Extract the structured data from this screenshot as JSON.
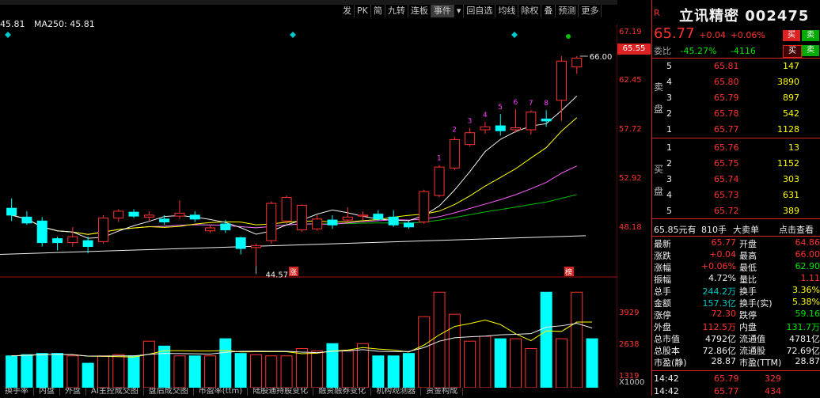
{
  "toolbar": [
    "发",
    "PK",
    "简",
    "九转",
    "连板",
    "事件",
    "",
    "回自选",
    "均线",
    "除权",
    "叠",
    "预测",
    "更多"
  ],
  "ma_legend": [
    {
      "label": "45.81",
      "color": "#ffffff"
    },
    {
      "label": "MA250: 45.81",
      "color": "#ffffff"
    }
  ],
  "axis": {
    "price_ticks": [
      "67.19",
      "62.45",
      "57.72",
      "52.92",
      "48.18"
    ],
    "price_tag": "65.55",
    "volume_ticks": [
      "3929",
      "2638",
      "1319"
    ],
    "volume_unit": "X1000"
  },
  "chart_labels": {
    "high": "66.00",
    "low": "44.57",
    "zhang": "涨",
    "bang": "榜",
    "counts": [
      "1",
      "2",
      "3",
      "4",
      "5",
      "6",
      "7",
      "8"
    ]
  },
  "chart_data": {
    "type": "candlestick",
    "candles": [
      {
        "o": 50.5,
        "c": 49.8,
        "h": 51.5,
        "l": 49.2
      },
      {
        "o": 49.6,
        "c": 49.0,
        "h": 50.2,
        "l": 48.8
      },
      {
        "o": 49.2,
        "c": 47.0,
        "h": 49.6,
        "l": 46.6
      },
      {
        "o": 47.4,
        "c": 47.0,
        "h": 47.6,
        "l": 46.2
      },
      {
        "o": 47.0,
        "c": 47.6,
        "h": 48.6,
        "l": 46.6
      },
      {
        "o": 47.2,
        "c": 46.6,
        "h": 47.6,
        "l": 45.9
      },
      {
        "o": 47.1,
        "c": 49.5,
        "h": 49.8,
        "l": 46.9
      },
      {
        "o": 49.5,
        "c": 50.2,
        "h": 50.4,
        "l": 49.1
      },
      {
        "o": 50.1,
        "c": 49.7,
        "h": 50.4,
        "l": 49.5
      },
      {
        "o": 49.6,
        "c": 49.8,
        "h": 50.2,
        "l": 49.2
      },
      {
        "o": 49.4,
        "c": 49.1,
        "h": 49.8,
        "l": 48.8
      },
      {
        "o": 49.7,
        "c": 50.0,
        "h": 51.3,
        "l": 49.4
      },
      {
        "o": 49.8,
        "c": 49.4,
        "h": 50.2,
        "l": 49.1
      },
      {
        "o": 48.2,
        "c": 48.5,
        "h": 48.8,
        "l": 48.0
      },
      {
        "o": 48.9,
        "c": 48.3,
        "h": 49.3,
        "l": 48.0
      },
      {
        "o": 47.5,
        "c": 46.4,
        "h": 47.6,
        "l": 45.8
      },
      {
        "o": 46.5,
        "c": 46.7,
        "h": 46.9,
        "l": 44.6
      },
      {
        "o": 47.2,
        "c": 51.0,
        "h": 51.2,
        "l": 46.9
      },
      {
        "o": 49.2,
        "c": 51.6,
        "h": 51.8,
        "l": 48.9
      },
      {
        "o": 48.3,
        "c": 50.8,
        "h": 50.9,
        "l": 48.1
      },
      {
        "o": 48.4,
        "c": 49.4,
        "h": 49.8,
        "l": 48.2
      },
      {
        "o": 49.3,
        "c": 48.8,
        "h": 49.8,
        "l": 48.4
      },
      {
        "o": 49.3,
        "c": 49.6,
        "h": 50.6,
        "l": 49.1
      },
      {
        "o": 49.7,
        "c": 49.8,
        "h": 50.2,
        "l": 49.3
      },
      {
        "o": 49.9,
        "c": 49.4,
        "h": 50.3,
        "l": 49.2
      },
      {
        "o": 49.6,
        "c": 48.8,
        "h": 50.3,
        "l": 48.6
      },
      {
        "o": 49.0,
        "c": 48.6,
        "h": 49.2,
        "l": 48.4
      },
      {
        "o": 49.1,
        "c": 52.2,
        "h": 52.4,
        "l": 48.9
      },
      {
        "o": 51.8,
        "c": 54.7,
        "h": 54.9,
        "l": 51.6
      },
      {
        "o": 54.6,
        "c": 57.5,
        "h": 57.8,
        "l": 54.4
      },
      {
        "o": 57.0,
        "c": 58.2,
        "h": 58.7,
        "l": 56.8
      },
      {
        "o": 58.5,
        "c": 58.8,
        "h": 59.3,
        "l": 58.1
      },
      {
        "o": 58.9,
        "c": 58.4,
        "h": 60.1,
        "l": 57.9
      },
      {
        "o": 58.5,
        "c": 58.7,
        "h": 60.6,
        "l": 58.2
      },
      {
        "o": 58.5,
        "c": 60.3,
        "h": 60.5,
        "l": 58.0
      },
      {
        "o": 59.6,
        "c": 59.4,
        "h": 60.5,
        "l": 58.8
      },
      {
        "o": 61.5,
        "c": 65.5,
        "h": 66.0,
        "l": 59.4
      },
      {
        "o": 64.9,
        "c": 65.8,
        "h": 66.0,
        "l": 64.2
      }
    ],
    "volumes": [
      1300,
      1350,
      1400,
      1400,
      1300,
      1000,
      1300,
      1350,
      1300,
      1900,
      1700,
      1300,
      1300,
      1300,
      2000,
      1400,
      1350,
      1300,
      1300,
      1600,
      1500,
      1800,
      1500,
      1800,
      1300,
      1300,
      1400,
      2900,
      3900,
      3000,
      1900,
      2100,
      2000,
      2000,
      1600,
      3900,
      2000,
      3900,
      2000
    ]
  },
  "stock": {
    "r_marker": "R",
    "name": "立讯精密 002475",
    "price": "65.77",
    "change": "+0.04",
    "change_pct": "+0.06%",
    "buy_btn": "买",
    "sell_btn": "卖",
    "ratio_label": "委比",
    "ratio": "-45.27%",
    "ratio_diff": "-4116",
    "side_sell": "卖盘",
    "side_buy": "买盘"
  },
  "asks": [
    {
      "lvl": "5",
      "price": "65.81",
      "vol": "147"
    },
    {
      "lvl": "4",
      "price": "65.80",
      "vol": "3890"
    },
    {
      "lvl": "3",
      "price": "65.79",
      "vol": "897"
    },
    {
      "lvl": "2",
      "price": "65.78",
      "vol": "542"
    },
    {
      "lvl": "1",
      "price": "65.77",
      "vol": "1128"
    }
  ],
  "bids": [
    {
      "lvl": "1",
      "price": "65.76",
      "vol": "13"
    },
    {
      "lvl": "2",
      "price": "65.75",
      "vol": "1152"
    },
    {
      "lvl": "3",
      "price": "65.74",
      "vol": "303"
    },
    {
      "lvl": "4",
      "price": "65.73",
      "vol": "631"
    },
    {
      "lvl": "5",
      "price": "65.72",
      "vol": "389"
    }
  ],
  "big_order": {
    "amount": "65.85元有",
    "hands": "810手",
    "label": "大卖单",
    "link": "点击查看"
  },
  "info": [
    {
      "k1": "最新",
      "v1": "65.77",
      "c1": "red",
      "k2": "开盘",
      "v2": "64.86",
      "c2": "red"
    },
    {
      "k1": "涨跌",
      "v1": "+0.04",
      "c1": "red",
      "k2": "最高",
      "v2": "66.00",
      "c2": "red"
    },
    {
      "k1": "涨幅",
      "v1": "+0.06%",
      "c1": "red",
      "k2": "最低",
      "v2": "62.90",
      "c2": "green"
    },
    {
      "k1": "振幅",
      "v1": "4.72%",
      "c1": "white",
      "k2": "量比",
      "v2": "1.11",
      "c2": "red"
    },
    {
      "k1": "总手",
      "v1": "244.2万",
      "c1": "cyan",
      "k2": "换手",
      "v2": "3.36%",
      "c2": "yellow"
    },
    {
      "k1": "金额",
      "v1": "157.3亿",
      "c1": "cyan",
      "k2": "换手(实)",
      "v2": "5.38%",
      "c2": "yellow"
    },
    {
      "k1": "涨停",
      "v1": "72.30",
      "c1": "red",
      "k2": "跌停",
      "v2": "59.16",
      "c2": "green"
    },
    {
      "k1": "外盘",
      "v1": "112.5万",
      "c1": "red",
      "k2": "内盘",
      "v2": "131.7万",
      "c2": "green"
    },
    {
      "k1": "总市值",
      "v1": "4792亿",
      "c1": "white",
      "k2": "流通值",
      "v2": "4781亿",
      "c2": "white"
    },
    {
      "k1": "总股本",
      "v1": "72.86亿",
      "c1": "white",
      "k2": "流通股",
      "v2": "72.69亿",
      "c2": "white"
    },
    {
      "k1": "市盈(静)",
      "v1": "28.87",
      "c1": "white",
      "k2": "市盈(TTM)",
      "v2": "28.87",
      "c2": "white"
    }
  ],
  "ticks": [
    {
      "time": "14:42",
      "price": "65.79",
      "vol": "329"
    },
    {
      "time": "14:42",
      "price": "65.77",
      "vol": "434"
    }
  ],
  "bottom_tabs": [
    "换手率",
    "内盘",
    "外盘",
    "AI主控成交图",
    "盘后成交图",
    "市盈率(ttm)",
    "陆股通持股变化",
    "融资融券变化",
    "机构观测器",
    "资金构成"
  ]
}
